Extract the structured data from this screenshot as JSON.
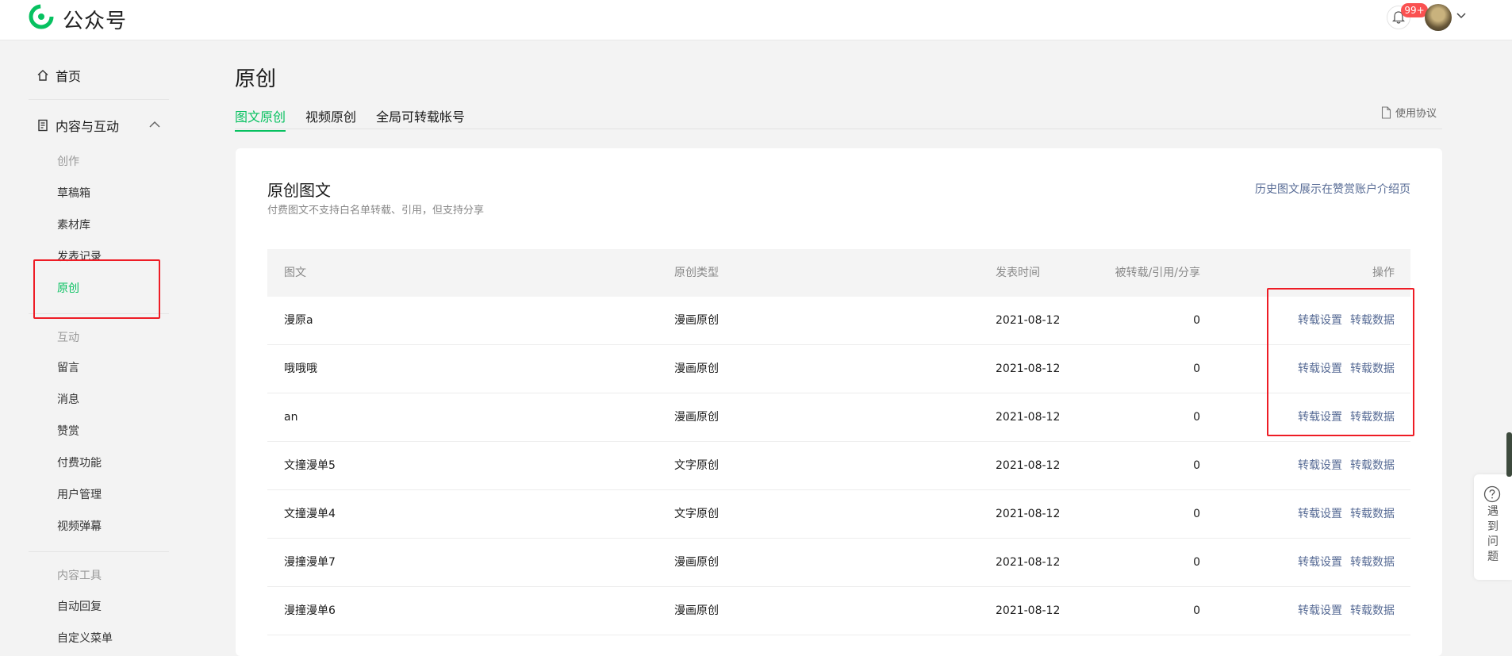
{
  "header": {
    "brand": "公众号",
    "notification_badge": "99+"
  },
  "sidebar": {
    "home": "首页",
    "content_section": "内容与互动",
    "groups": [
      {
        "title": "创作",
        "items": [
          "草稿箱",
          "素材库",
          "发表记录",
          "原创"
        ]
      },
      {
        "title": "互动",
        "items": [
          "留言",
          "消息",
          "赞赏",
          "付费功能",
          "用户管理",
          "视频弹幕"
        ]
      },
      {
        "title": "内容工具",
        "items": [
          "自动回复",
          "自定义菜单"
        ]
      }
    ],
    "active_item": "原创"
  },
  "main": {
    "title": "原创",
    "tabs": [
      "图文原创",
      "视频原创",
      "全局可转载帐号"
    ],
    "active_tab": "图文原创",
    "agreement": "使用协议",
    "card": {
      "title": "原创图文",
      "subtitle": "付费图文不支持白名单转载、引用，但支持分享",
      "history_link": "历史图文展示在赞赏账户介绍页"
    },
    "table": {
      "headers": [
        "图文",
        "原创类型",
        "发表时间",
        "被转载/引用/分享",
        "操作"
      ],
      "rows": [
        {
          "title": "漫原a",
          "type": "漫画原创",
          "date": "2021-08-12",
          "count": "0",
          "action1": "转载设置",
          "action2": "转载数据"
        },
        {
          "title": "哦哦哦",
          "type": "漫画原创",
          "date": "2021-08-12",
          "count": "0",
          "action1": "转载设置",
          "action2": "转载数据"
        },
        {
          "title": "an",
          "type": "漫画原创",
          "date": "2021-08-12",
          "count": "0",
          "action1": "转载设置",
          "action2": "转载数据"
        },
        {
          "title": "文撞漫单5",
          "type": "文字原创",
          "date": "2021-08-12",
          "count": "0",
          "action1": "转载设置",
          "action2": "转载数据"
        },
        {
          "title": "文撞漫单4",
          "type": "文字原创",
          "date": "2021-08-12",
          "count": "0",
          "action1": "转载设置",
          "action2": "转载数据"
        },
        {
          "title": "漫撞漫单7",
          "type": "漫画原创",
          "date": "2021-08-12",
          "count": "0",
          "action1": "转载设置",
          "action2": "转载数据"
        },
        {
          "title": "漫撞漫单6",
          "type": "漫画原创",
          "date": "2021-08-12",
          "count": "0",
          "action1": "转载设置",
          "action2": "转载数据"
        }
      ]
    }
  },
  "help_widget": {
    "label": "遇到问题"
  },
  "colors": {
    "brand_green": "#07c160",
    "link_blue": "#576b95",
    "badge_red": "#fa5151",
    "highlight_red": "#ee1c25"
  }
}
